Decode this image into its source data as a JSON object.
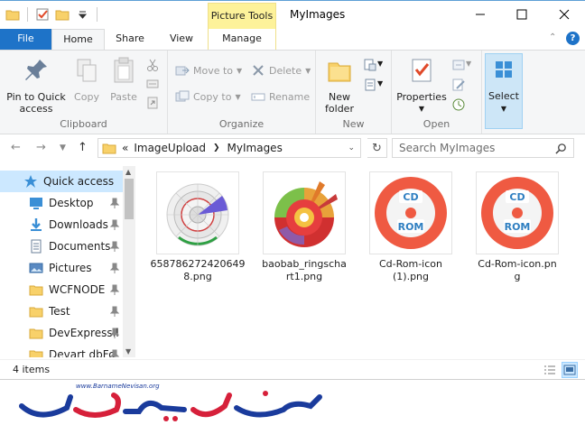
{
  "window": {
    "title": "MyImages",
    "context_tab": "Picture Tools"
  },
  "tabs": {
    "file": "File",
    "home": "Home",
    "share": "Share",
    "view": "View",
    "manage": "Manage",
    "help": "?"
  },
  "ribbon": {
    "clipboard": {
      "label": "Clipboard",
      "pin": "Pin to Quick access",
      "copy": "Copy",
      "paste": "Paste"
    },
    "organize": {
      "label": "Organize",
      "move_to": "Move to",
      "copy_to": "Copy to",
      "delete": "Delete",
      "rename": "Rename"
    },
    "new": {
      "label": "New",
      "new_folder": "New folder"
    },
    "open": {
      "label": "Open",
      "properties": "Properties"
    },
    "select": {
      "label": "Select"
    }
  },
  "address": {
    "crumbs": [
      "«",
      "ImageUpload",
      "MyImages"
    ],
    "search_placeholder": "Search MyImages"
  },
  "navpane": {
    "items": [
      {
        "label": "Quick access",
        "icon": "star-icon",
        "selected": true
      },
      {
        "label": "Desktop",
        "icon": "desktop-icon",
        "pinned": true
      },
      {
        "label": "Downloads",
        "icon": "download-icon",
        "pinned": true
      },
      {
        "label": "Documents",
        "icon": "documents-icon",
        "pinned": true
      },
      {
        "label": "Pictures",
        "icon": "pictures-icon",
        "pinned": true
      },
      {
        "label": "WCFNODE",
        "icon": "folder-icon",
        "pinned": true
      },
      {
        "label": "Test",
        "icon": "folder-icon",
        "pinned": true
      },
      {
        "label": "DevExpress.l",
        "icon": "folder-icon",
        "pinned": true
      },
      {
        "label": "Devart dbFo",
        "icon": "folder-icon",
        "pinned": true
      }
    ]
  },
  "files": [
    {
      "name": "6587862724206498.png",
      "line1": "658786272420649",
      "line2": "8.png",
      "thumb": "sunburst-gray"
    },
    {
      "name": "baobab_ringschart1.png",
      "line1": "baobab_ringscha",
      "line2": "rt1.png",
      "thumb": "sunburst-color"
    },
    {
      "name": "Cd-Rom-icon (1).png",
      "line1": "Cd-Rom-icon",
      "line2": "(1).png",
      "thumb": "cdrom"
    },
    {
      "name": "Cd-Rom-icon.png",
      "line1": "Cd-Rom-icon.pn",
      "line2": "g",
      "thumb": "cdrom"
    }
  ],
  "cd_label": {
    "top": "CD",
    "bottom": "ROM"
  },
  "status": {
    "count": "4 items"
  },
  "watermark": {
    "url": "www.BarnameNevisan.org",
    "logo_text": "برنامه نویسان"
  },
  "colors": {
    "accent": "#1e73c8",
    "context_tab": "#fdf29a",
    "selection": "#cce8ff",
    "cd_red": "#ef5a42",
    "cd_blue": "#2f7fc1"
  }
}
